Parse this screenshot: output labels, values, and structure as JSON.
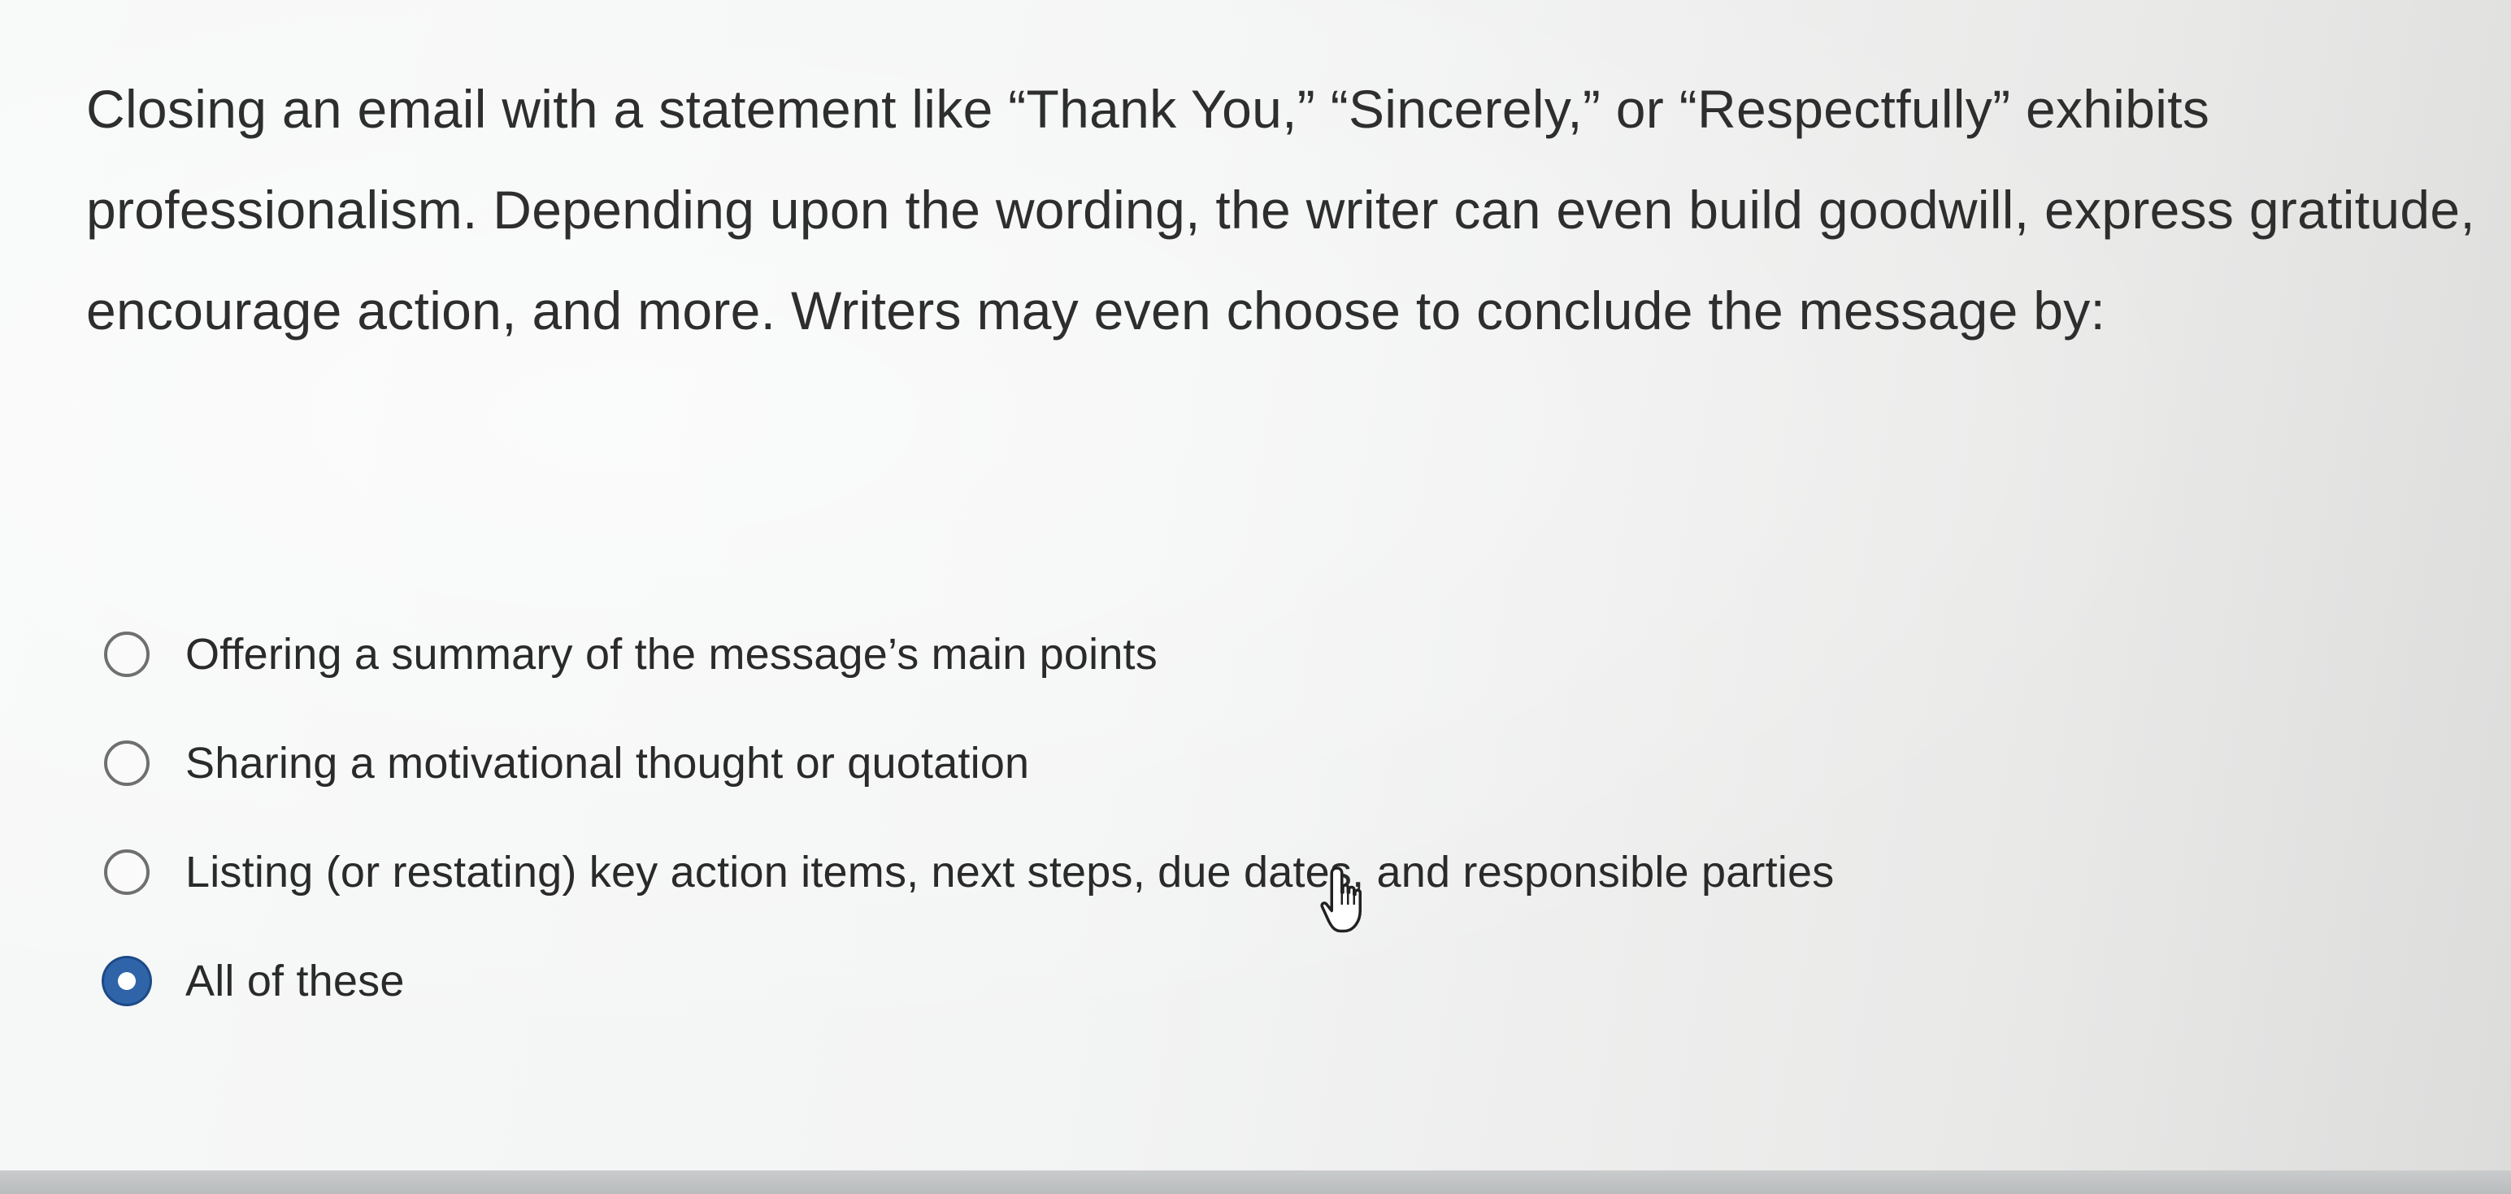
{
  "question": {
    "text": "Closing an email with a statement like “Thank You,” “Sincerely,” or “Respectfully” exhibits professionalism. Depending upon the wording, the writer can even build goodwill, express gratitude, encourage action, and more. Writers may even choose to conclude the message by:"
  },
  "options": [
    {
      "label": "Offering a summary of the message’s main points",
      "selected": false
    },
    {
      "label": "Sharing a motivational thought or quotation",
      "selected": false
    },
    {
      "label": "Listing (or restating) key action items, next steps, due dates, and responsible parties",
      "selected": false
    },
    {
      "label": "All of these",
      "selected": true
    }
  ],
  "colors": {
    "selected_radio": "#2f64a9",
    "text": "#2e2e2e"
  },
  "cursor": {
    "icon": "hand-pointer-icon"
  }
}
